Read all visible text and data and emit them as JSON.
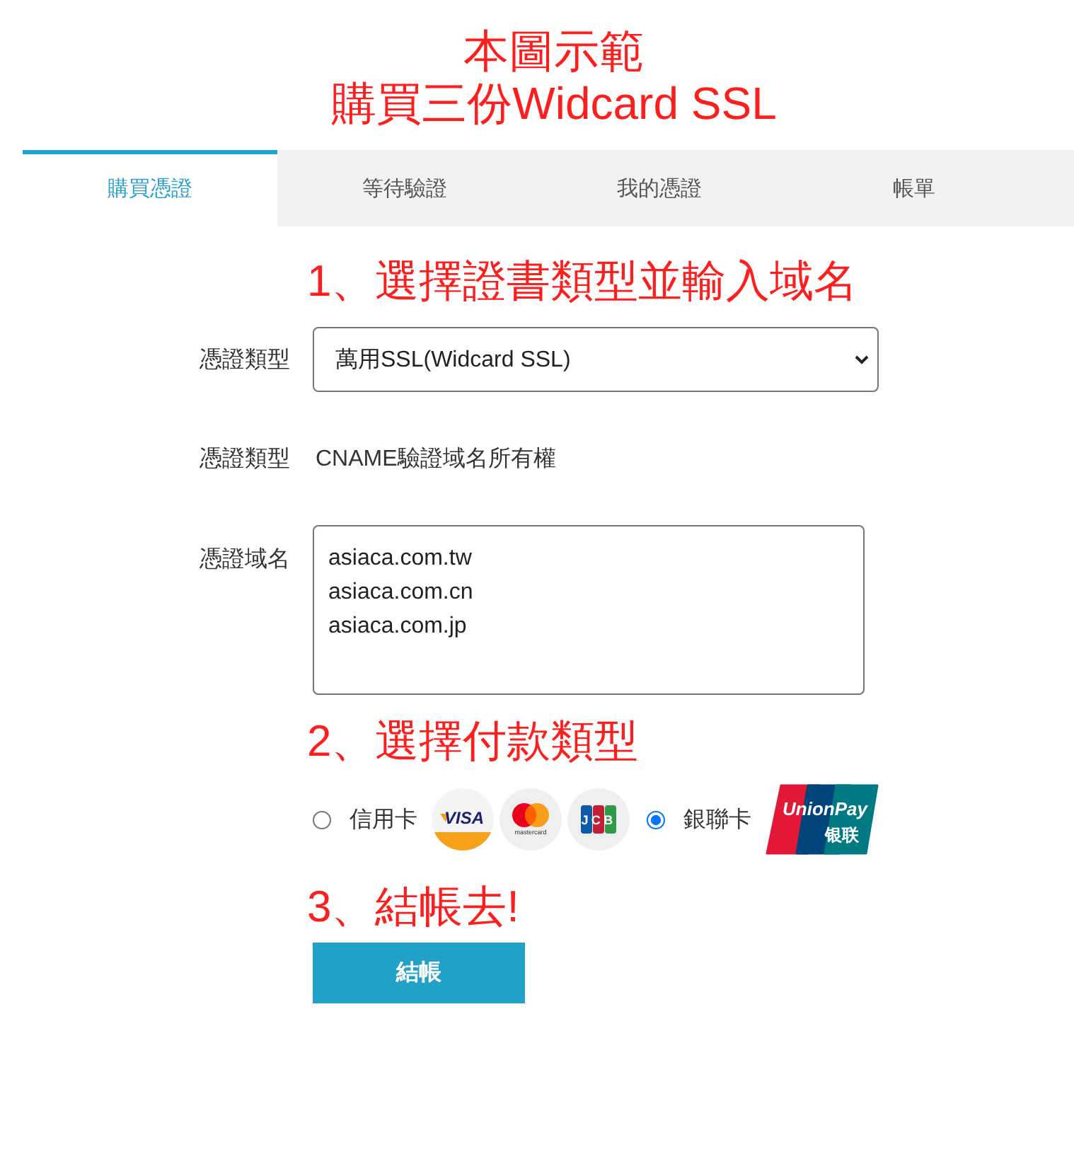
{
  "annotation": {
    "title_lines": [
      "本圖示範",
      "購買三份Widcard SSL"
    ]
  },
  "tabs": [
    {
      "label": "購買憑證",
      "selected": true
    },
    {
      "label": "等待驗證",
      "selected": false
    },
    {
      "label": "我的憑證",
      "selected": false
    },
    {
      "label": "帳單",
      "selected": false
    }
  ],
  "form": {
    "step_1": "1、選擇證書類型並輸入域名",
    "fields": [
      {
        "kind": "select",
        "label": "憑證類型",
        "value": "萬用SSL(Widcard SSL)"
      },
      {
        "kind": "text",
        "label": "憑證類型",
        "value": "CNAME驗證域名所有權"
      },
      {
        "kind": "textarea",
        "label": "憑證域名",
        "value": "asiaca.com.tw\nasiaca.com.cn\nasiaca.com.jp"
      }
    ],
    "step_2": "2、選擇付款類型",
    "payment_options": [
      {
        "label": "信用卡",
        "selected": false,
        "logos": [
          {
            "kind": "visa",
            "text": "VISA"
          },
          {
            "kind": "mastercard",
            "text": "mastercard"
          },
          {
            "kind": "jcb",
            "text": "JCB"
          }
        ]
      },
      {
        "label": "銀聯卡",
        "selected": true,
        "logos": [
          {
            "kind": "unionpay",
            "text": "UnionPay",
            "subtext": "银联"
          }
        ]
      }
    ],
    "step_3": "3、結帳去!",
    "checkout_button": "結帳"
  }
}
